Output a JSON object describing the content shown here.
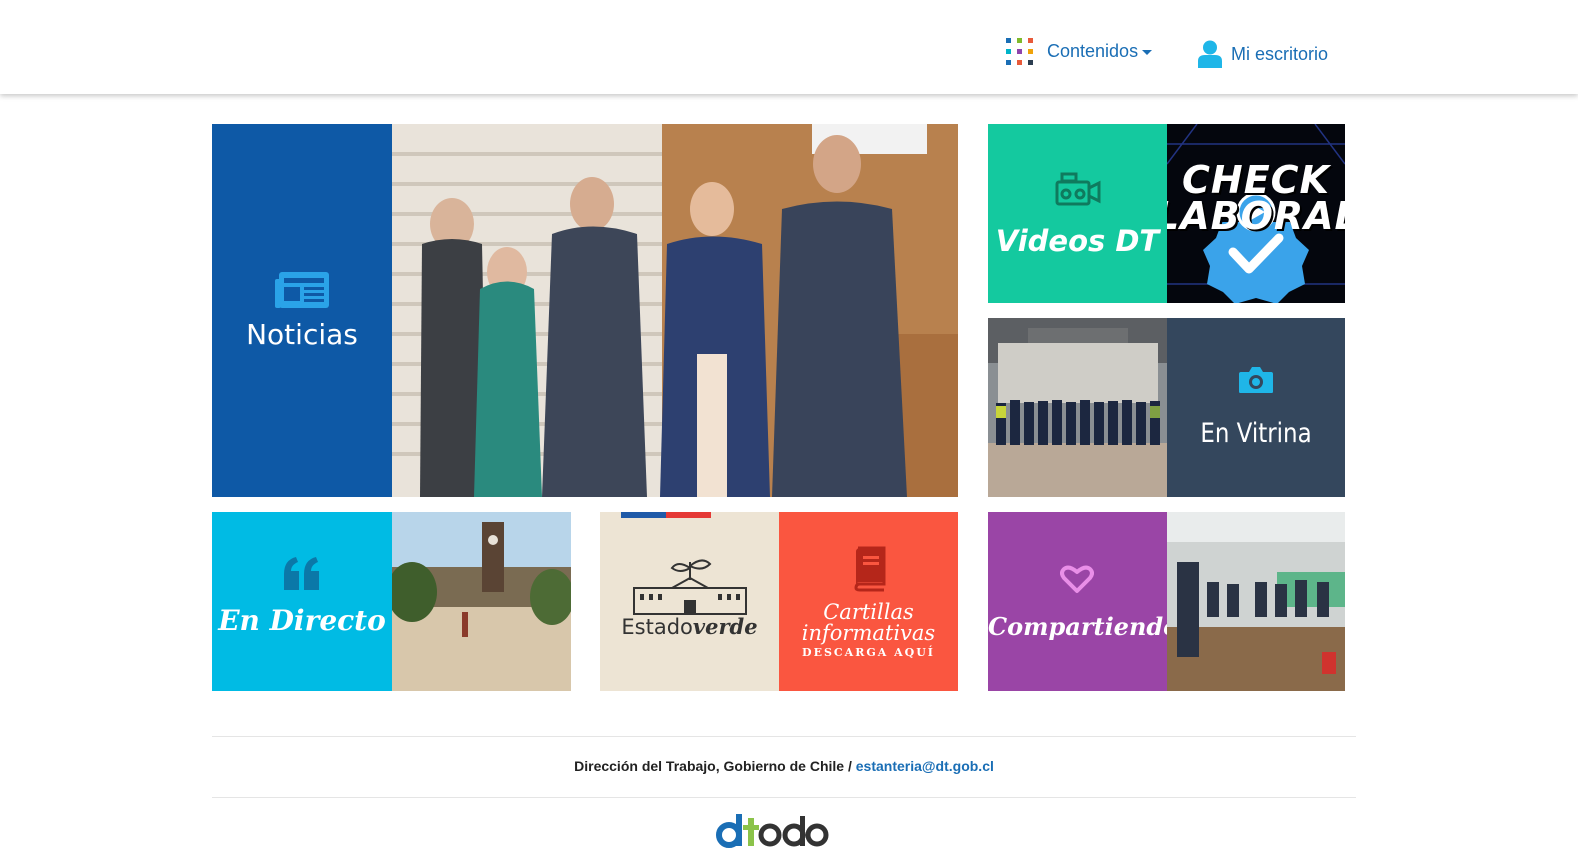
{
  "header": {
    "contenidos_label": "Contenidos",
    "escritorio_label": "Mi escritorio",
    "grid_colors": [
      "#1a6eb5",
      "#7fba2d",
      "#e85a3a",
      "#00b3c8",
      "#8e44ad",
      "#f0a30a",
      "#1a6eb5",
      "#e85a3a",
      "#2c3e50"
    ]
  },
  "tiles": {
    "noticias": {
      "label": "Noticias",
      "color": "#0e59a6"
    },
    "videos": {
      "label": "Videos DT",
      "color": "#14c99f"
    },
    "check_laboral": {
      "line1": "CHECK",
      "line2": "LABORAL"
    },
    "vitrina": {
      "label": "En Vitrina",
      "color": "#34475d"
    },
    "directo": {
      "label": "En Directo",
      "color": "#00bbe4"
    },
    "estado_verde": {
      "word1": "Estado",
      "word2": "verde"
    },
    "cartillas": {
      "line1": "Cartillas",
      "line2": "informativas",
      "line3": "DESCARGA AQUÍ",
      "color": "#fa5640"
    },
    "compartiendo": {
      "label": "Compartiendo",
      "color": "#9a45a6"
    }
  },
  "footer": {
    "text": "Dirección del Trabajo, Gobierno de Chile / ",
    "email": "estanteria@dt.gob.cl",
    "logo_text": "dtodos"
  }
}
